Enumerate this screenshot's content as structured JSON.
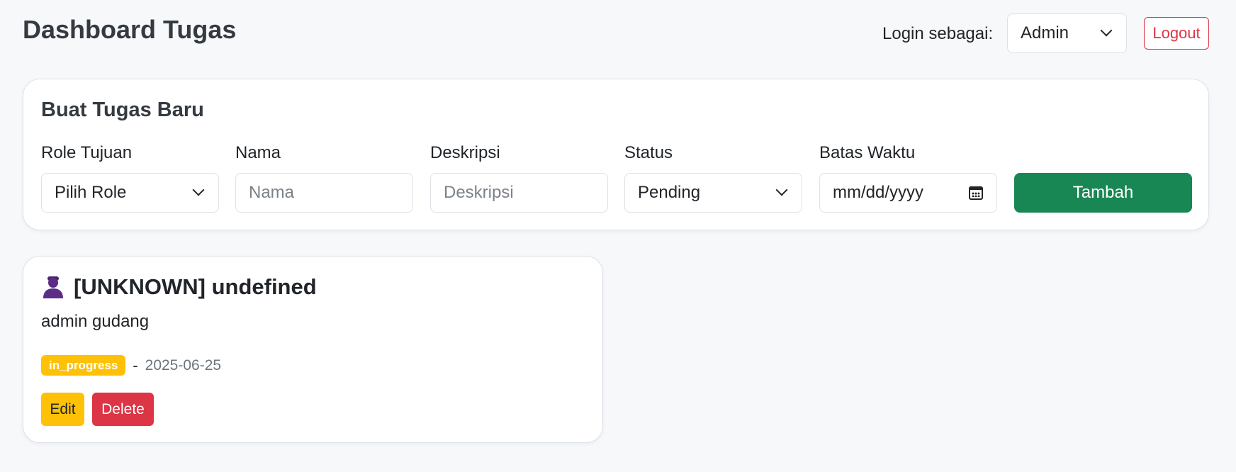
{
  "header": {
    "title": "Dashboard Tugas",
    "login_label": "Login sebagai:",
    "role_value": "Admin",
    "logout_label": "Logout"
  },
  "form": {
    "title": "Buat Tugas Baru",
    "fields": {
      "role": {
        "label": "Role Tujuan",
        "value": "Pilih Role"
      },
      "name": {
        "label": "Nama",
        "placeholder": "Nama"
      },
      "description": {
        "label": "Deskripsi",
        "placeholder": "Deskripsi"
      },
      "status": {
        "label": "Status",
        "value": "Pending"
      },
      "deadline": {
        "label": "Batas Waktu",
        "placeholder": "mm/dd/yyyy"
      }
    },
    "submit_label": "Tambah"
  },
  "tasks": [
    {
      "title": "[UNKNOWN] undefined",
      "description": "admin gudang",
      "status": "in_progress",
      "separator": "-",
      "date": "2025-06-25",
      "edit_label": "Edit",
      "delete_label": "Delete",
      "icon": "user-icon"
    }
  ],
  "colors": {
    "primary_green": "#198754",
    "danger": "#dc3545",
    "warning": "#ffc107",
    "background": "#f7f8fa",
    "icon_purple": "#5b2d86"
  }
}
